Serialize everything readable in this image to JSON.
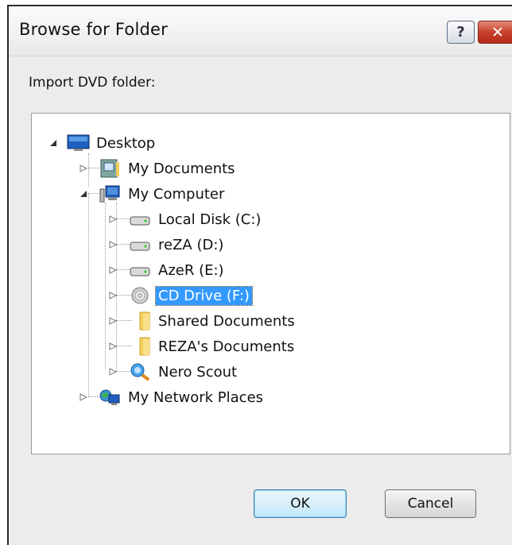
{
  "window": {
    "title": "Browse for Folder",
    "help_button": "?",
    "close_button": "✕"
  },
  "prompt": "Import DVD folder:",
  "tree": {
    "items": [
      {
        "label": "Desktop",
        "icon": "desktop-icon",
        "state": "expanded"
      },
      {
        "label": "My Documents",
        "icon": "my-documents-icon",
        "state": "collapsed"
      },
      {
        "label": "My Computer",
        "icon": "my-computer-icon",
        "state": "expanded"
      },
      {
        "label": "Local Disk (C:)",
        "icon": "hard-drive-icon",
        "state": "collapsed"
      },
      {
        "label": "reZA (D:)",
        "icon": "hard-drive-icon",
        "state": "collapsed"
      },
      {
        "label": "AzeR (E:)",
        "icon": "hard-drive-icon",
        "state": "collapsed"
      },
      {
        "label": "CD Drive (F:)",
        "icon": "cd-drive-icon",
        "state": "collapsed",
        "selected": true
      },
      {
        "label": "Shared Documents",
        "icon": "folder-icon",
        "state": "collapsed"
      },
      {
        "label": "REZA's Documents",
        "icon": "folder-icon",
        "state": "collapsed"
      },
      {
        "label": "Nero Scout",
        "icon": "nero-scout-icon",
        "state": "collapsed"
      },
      {
        "label": "My Network Places",
        "icon": "network-places-icon",
        "state": "collapsed"
      }
    ]
  },
  "buttons": {
    "ok": "OK",
    "cancel": "Cancel"
  },
  "colors": {
    "selection": "#3399ff",
    "close_button": "#c7412d",
    "folder": "#f5cf5c"
  }
}
